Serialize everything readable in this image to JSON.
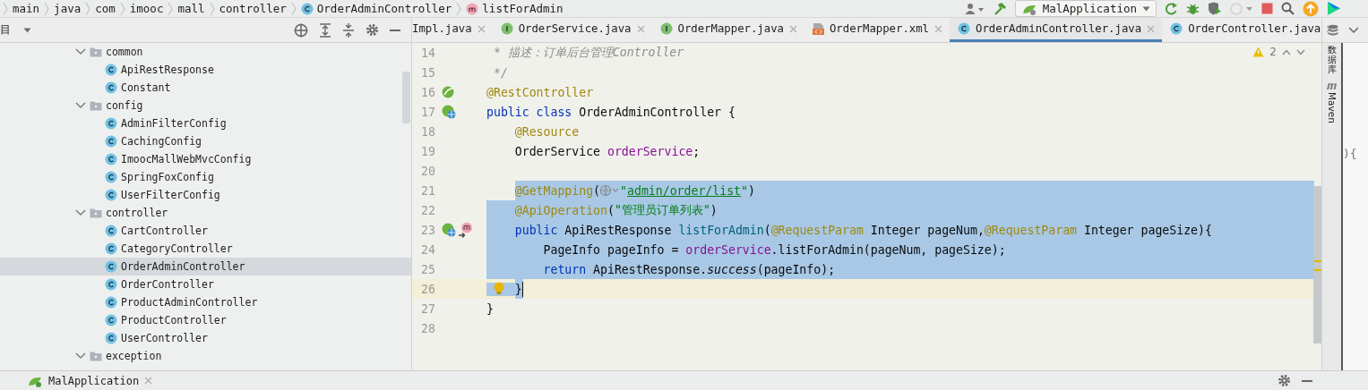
{
  "breadcrumb": [
    {
      "label": "main",
      "kind": "folder"
    },
    {
      "label": "java",
      "kind": "folder"
    },
    {
      "label": "com",
      "kind": "folder"
    },
    {
      "label": "imooc",
      "kind": "folder"
    },
    {
      "label": "mall",
      "kind": "folder"
    },
    {
      "label": "controller",
      "kind": "folder"
    },
    {
      "label": "OrderAdminController",
      "kind": "class"
    },
    {
      "label": "listForAdmin",
      "kind": "method"
    }
  ],
  "toolbar": {
    "run_config": "MalApplication"
  },
  "project_panel": {
    "title": "目",
    "tree": [
      {
        "label": "common",
        "kind": "package",
        "expanded": true,
        "selected": false,
        "children": [
          {
            "label": "ApiRestResponse",
            "kind": "class",
            "selected": false
          },
          {
            "label": "Constant",
            "kind": "class",
            "selected": false
          }
        ]
      },
      {
        "label": "config",
        "kind": "package",
        "expanded": true,
        "selected": false,
        "children": [
          {
            "label": "AdminFilterConfig",
            "kind": "class",
            "selected": false
          },
          {
            "label": "CachingConfig",
            "kind": "class",
            "selected": false
          },
          {
            "label": "ImoocMallWebMvcConfig",
            "kind": "class",
            "selected": false
          },
          {
            "label": "SpringFoxConfig",
            "kind": "class",
            "selected": false
          },
          {
            "label": "UserFilterConfig",
            "kind": "class",
            "selected": false
          }
        ]
      },
      {
        "label": "controller",
        "kind": "package",
        "expanded": true,
        "selected": false,
        "children": [
          {
            "label": "CartController",
            "kind": "class",
            "selected": false
          },
          {
            "label": "CategoryController",
            "kind": "class",
            "selected": false
          },
          {
            "label": "OrderAdminController",
            "kind": "class",
            "selected": true
          },
          {
            "label": "OrderController",
            "kind": "class",
            "selected": false
          },
          {
            "label": "ProductAdminController",
            "kind": "class",
            "selected": false
          },
          {
            "label": "ProductController",
            "kind": "class",
            "selected": false
          },
          {
            "label": "UserController",
            "kind": "class",
            "selected": false
          }
        ]
      },
      {
        "label": "exception",
        "kind": "package",
        "expanded": true,
        "selected": false
      }
    ]
  },
  "tabs": [
    {
      "label": "Impl.java",
      "kind": "cut",
      "selected": false
    },
    {
      "label": "OrderService.java",
      "kind": "interface",
      "selected": false
    },
    {
      "label": "OrderMapper.java",
      "kind": "interface",
      "selected": false
    },
    {
      "label": "OrderMapper.xml",
      "kind": "xml",
      "selected": false
    },
    {
      "label": "OrderAdminController.java",
      "kind": "class",
      "selected": true
    },
    {
      "label": "OrderController.java",
      "kind": "class",
      "selected": false
    }
  ],
  "editor": {
    "warnings": "2",
    "lines": [
      {
        "number": "14",
        "selected": false,
        "current": false,
        "tokens": [
          {
            "text": " * 描述：订单后台管理Controller",
            "kind": "comment"
          }
        ]
      },
      {
        "number": "15",
        "selected": false,
        "current": false,
        "tokens": [
          {
            "text": " */",
            "kind": "comment"
          }
        ]
      },
      {
        "number": "16",
        "selected": false,
        "current": false,
        "gutter_icons": [
          {
            "kind": "bean"
          }
        ],
        "tokens": [
          {
            "text": "@RestController",
            "kind": "annotation"
          }
        ]
      },
      {
        "number": "17",
        "selected": false,
        "current": false,
        "gutter_icons": [
          {
            "kind": "bean-web"
          }
        ],
        "tokens": [
          {
            "text": "public class ",
            "kind": "keyword"
          },
          {
            "text": "OrderAdminController {",
            "kind": "plain"
          }
        ]
      },
      {
        "number": "18",
        "selected": false,
        "current": false,
        "tokens": [
          {
            "text": "    @Resource",
            "kind": "annotation"
          }
        ]
      },
      {
        "number": "19",
        "selected": false,
        "current": false,
        "tokens": [
          {
            "text": "    OrderService ",
            "kind": "plain"
          },
          {
            "text": "orderService",
            "kind": "field"
          },
          {
            "text": ";",
            "kind": "plain"
          }
        ]
      },
      {
        "number": "20",
        "selected": false,
        "current": false
      },
      {
        "number": "21",
        "selected": true,
        "current": false,
        "tokens": [
          {
            "text": "    @GetMapping",
            "kind": "annotation"
          },
          {
            "text": "(",
            "kind": "plain"
          },
          {
            "kind": "globe"
          },
          {
            "text": "\"",
            "kind": "string"
          },
          {
            "text": "admin/order/list",
            "kind": "link"
          },
          {
            "text": "\"",
            "kind": "string"
          },
          {
            "text": ")",
            "kind": "plain"
          }
        ]
      },
      {
        "number": "22",
        "selected": true,
        "current": false,
        "tokens": [
          {
            "text": "    @ApiOperation",
            "kind": "annotation"
          },
          {
            "text": "(",
            "kind": "plain"
          },
          {
            "text": "\"管理员订单列表\"",
            "kind": "string"
          },
          {
            "text": ")",
            "kind": "plain"
          }
        ]
      },
      {
        "number": "23",
        "selected": true,
        "current": false,
        "gutter_icons": [
          {
            "kind": "bean-web"
          },
          {
            "kind": "method-impl"
          }
        ],
        "tokens": [
          {
            "text": "    public ",
            "kind": "keyword"
          },
          {
            "text": "ApiRestResponse ",
            "kind": "plain"
          },
          {
            "text": "listForAdmin",
            "kind": "decl"
          },
          {
            "text": "(",
            "kind": "plain"
          },
          {
            "text": "@RequestParam",
            "kind": "annotation"
          },
          {
            "text": " Integer pageNum,",
            "kind": "plain"
          },
          {
            "text": "@RequestParam",
            "kind": "annotation"
          },
          {
            "text": " Integer pageSize){",
            "kind": "plain"
          }
        ]
      },
      {
        "number": "24",
        "selected": true,
        "current": false,
        "tokens": [
          {
            "text": "        PageInfo pageInfo = ",
            "kind": "plain"
          },
          {
            "text": "orderService",
            "kind": "field"
          },
          {
            "text": ".listForAdmin(pageNum, pageSize);",
            "kind": "plain"
          }
        ]
      },
      {
        "number": "25",
        "selected": true,
        "current": false,
        "tokens": [
          {
            "text": "        return ",
            "kind": "keyword"
          },
          {
            "text": "ApiRestResponse.",
            "kind": "plain"
          },
          {
            "text": "success",
            "kind": "static"
          },
          {
            "text": "(pageInfo);",
            "kind": "plain"
          }
        ]
      },
      {
        "number": "26",
        "selected": true,
        "current": true,
        "gutter_icons": [
          {
            "kind": "bulb"
          }
        ],
        "tokens": [
          {
            "text": "    }",
            "kind": "plain"
          }
        ]
      },
      {
        "number": "27",
        "selected": false,
        "current": false,
        "tokens": [
          {
            "text": "}",
            "kind": "plain"
          }
        ]
      },
      {
        "number": "28",
        "selected": false,
        "current": false
      }
    ]
  },
  "side_tools": [
    {
      "label": "数据库",
      "kind": "database"
    },
    {
      "label": "Maven",
      "kind": "maven"
    }
  ],
  "background_window": {
    "text": "){"
  },
  "run_panel": {
    "tab": "MalApplication"
  }
}
